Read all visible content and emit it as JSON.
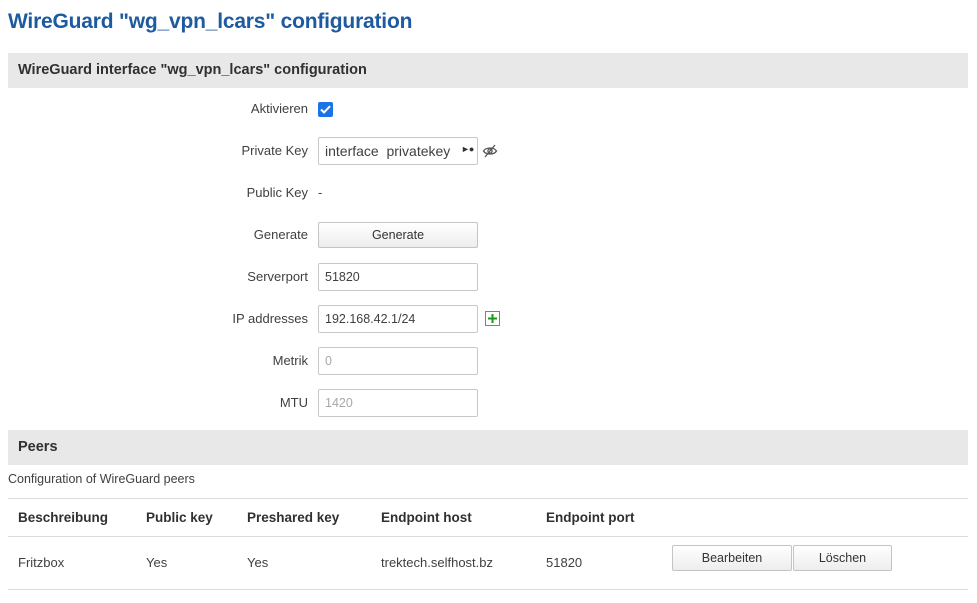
{
  "page": {
    "title": "WireGuard \"wg_vpn_lcars\" configuration"
  },
  "interface_section": {
    "title": "WireGuard interface \"wg_vpn_lcars\" configuration",
    "fields": {
      "enable": {
        "label": "Aktivieren",
        "checked": true
      },
      "private_key": {
        "label": "Private Key",
        "value": "interface  privatekey"
      },
      "public_key": {
        "label": "Public Key",
        "value": "-"
      },
      "generate": {
        "label": "Generate",
        "button": "Generate"
      },
      "serverport": {
        "label": "Serverport",
        "value": "51820"
      },
      "ip_addresses": {
        "label": "IP addresses",
        "value": "192.168.42.1/24"
      },
      "metric": {
        "label": "Metrik",
        "placeholder": "0"
      },
      "mtu": {
        "label": "MTU",
        "placeholder": "1420"
      }
    }
  },
  "peers_section": {
    "title": "Peers",
    "description": "Configuration of WireGuard peers",
    "columns": [
      "Beschreibung",
      "Public key",
      "Preshared key",
      "Endpoint host",
      "Endpoint port"
    ],
    "rows": [
      {
        "description": "Fritzbox",
        "public_key": "Yes",
        "preshared_key": "Yes",
        "endpoint_host": "trektech.selfhost.bz",
        "endpoint_port": "51820"
      }
    ],
    "edit_button": "Bearbeiten",
    "delete_button": "Löschen"
  },
  "colors": {
    "title": "#1e5aa0",
    "checkbox": "#1a73e8",
    "header_bg": "#e8e8e8",
    "add_icon": "#1a9a1a"
  },
  "icons": {
    "reveal": "eye-slash-icon",
    "add": "plus-icon",
    "check": "checkmark-icon"
  }
}
